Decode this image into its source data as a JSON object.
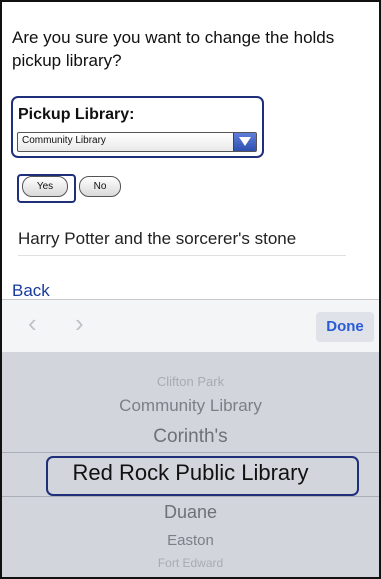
{
  "question": "Are you sure you want to change the holds pickup library?",
  "pickup": {
    "label": "Pickup Library:",
    "selected": "Community Library"
  },
  "buttons": {
    "yes": "Yes",
    "no": "No"
  },
  "item_title": "Harry Potter and the sorcerer's stone",
  "back_link": "Back",
  "toolbar": {
    "prev": "‹",
    "next": "›",
    "done": "Done"
  },
  "picker": {
    "options": [
      "Clifton Park",
      "Community Library",
      "Corinth's",
      "Red Rock Public Library",
      "Duane",
      "Easton",
      "Fort Edward"
    ],
    "selected_index": 3
  },
  "colors": {
    "highlight_outline": "#1f2f7a",
    "link": "#1a3a9c",
    "done": "#2a5bd7",
    "picker_bg": "#d2d5dc"
  }
}
